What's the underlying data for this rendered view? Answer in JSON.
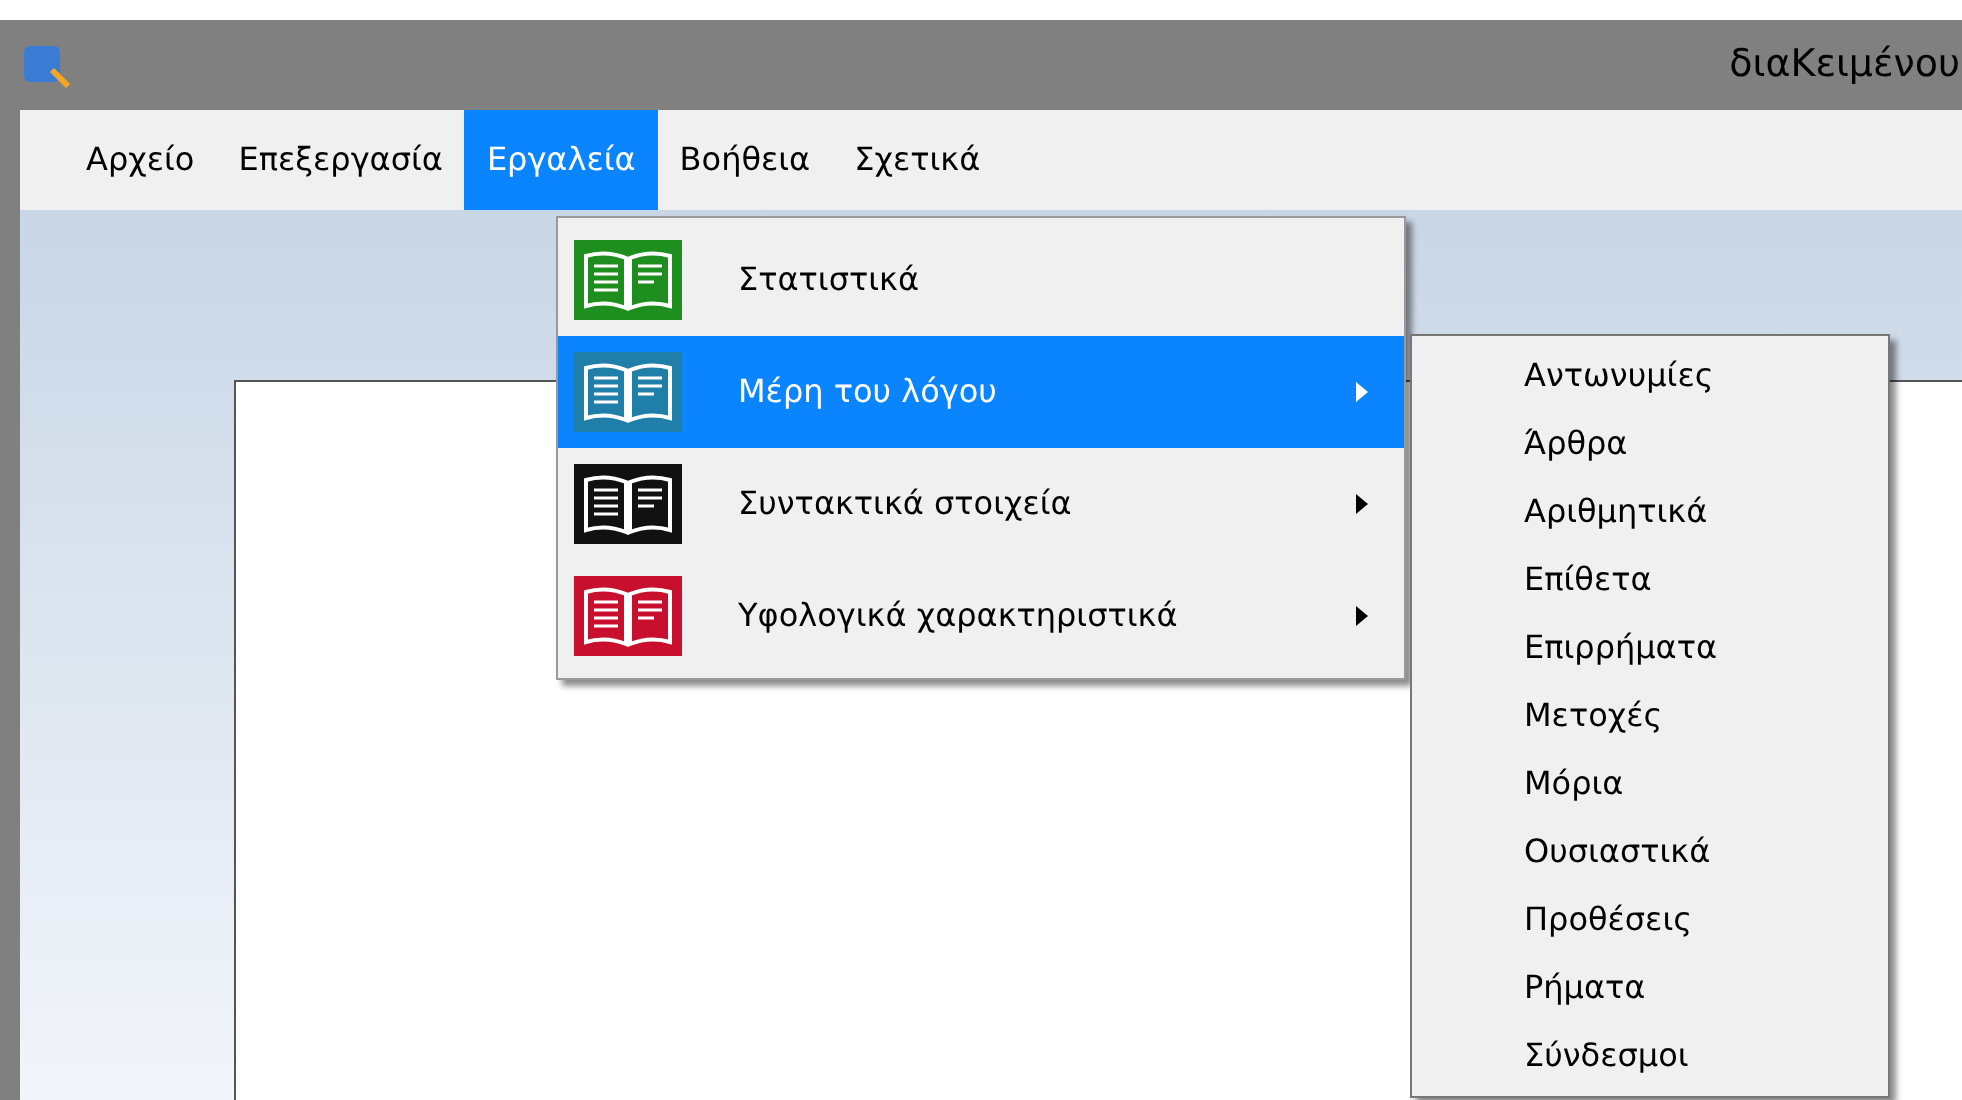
{
  "window": {
    "title": "διαΚειμένου"
  },
  "menubar": [
    {
      "label": "Αρχείο",
      "selected": false
    },
    {
      "label": "Επεξεργασία",
      "selected": false
    },
    {
      "label": "Εργαλεία",
      "selected": true
    },
    {
      "label": "Βοήθεια",
      "selected": false
    },
    {
      "label": "Σχετικά",
      "selected": false
    }
  ],
  "dropdown": {
    "items": [
      {
        "label": "Στατιστικά",
        "color": "#1e8f1e",
        "selected": false,
        "has_submenu": false
      },
      {
        "label": "Μέρη του λόγου",
        "color": "#1f7fa8",
        "selected": true,
        "has_submenu": true
      },
      {
        "label": "Συντακτικά στοιχεία",
        "color": "#111111",
        "selected": false,
        "has_submenu": true
      },
      {
        "label": "Υφολογικά χαρακτηριστικά",
        "color": "#c8102e",
        "selected": false,
        "has_submenu": true
      }
    ]
  },
  "submenu": {
    "items": [
      "Αντωνυμίες",
      "Άρθρα",
      "Αριθμητικά",
      "Επίθετα",
      "Επιρρήματα",
      "Μετοχές",
      "Μόρια",
      "Ουσιαστικά",
      "Προθέσεις",
      "Ρήματα",
      "Σύνδεσμοι"
    ]
  }
}
